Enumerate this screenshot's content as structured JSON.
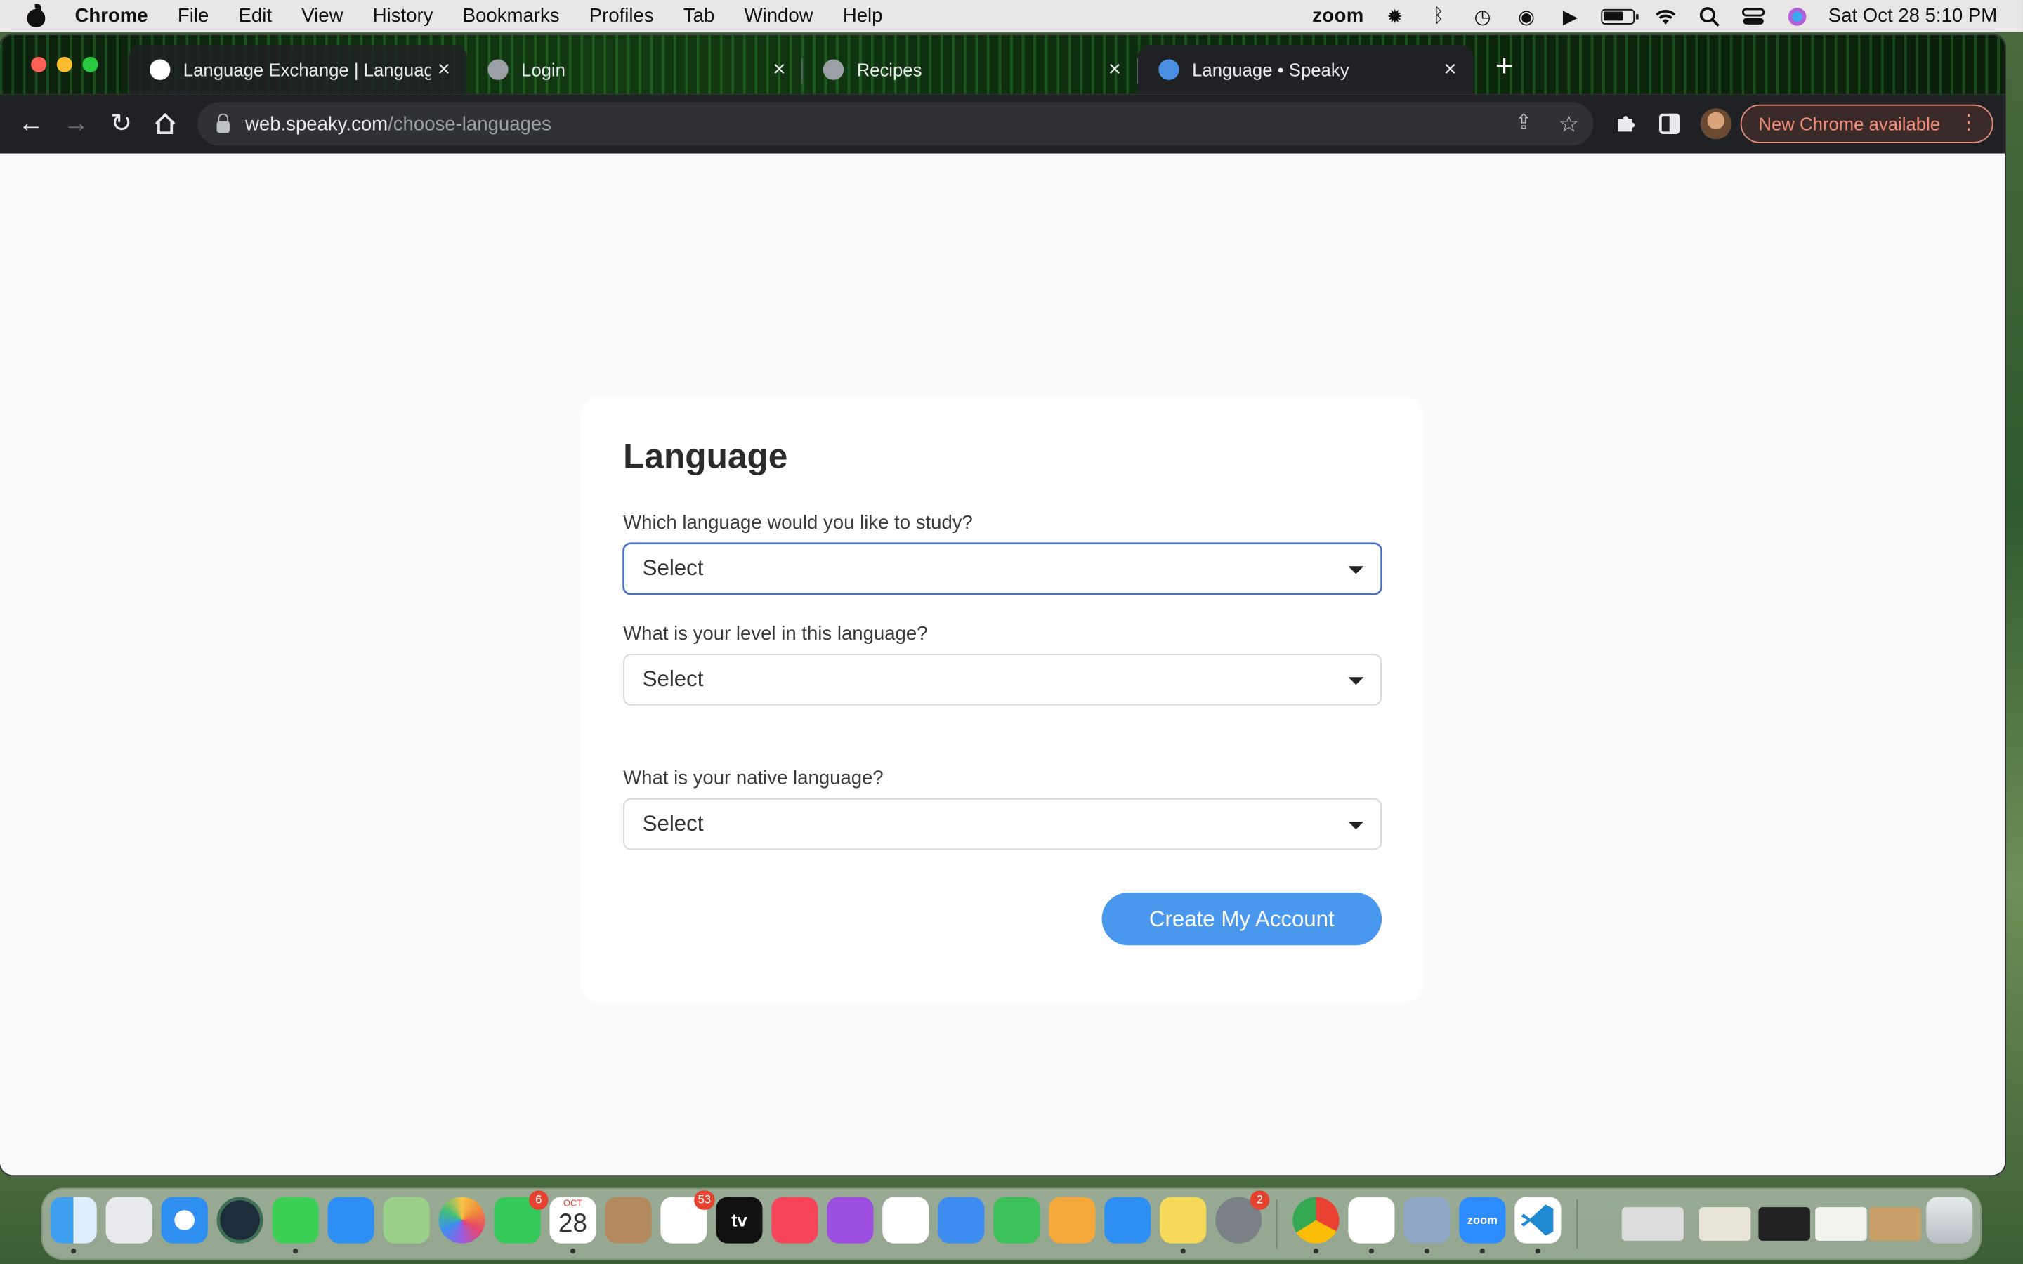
{
  "menubar": {
    "app_name": "Chrome",
    "items": [
      "File",
      "Edit",
      "View",
      "History",
      "Bookmarks",
      "Profiles",
      "Tab",
      "Window",
      "Help"
    ],
    "status_icons": [
      "zoom-icon",
      "brightness-icon",
      "bluetooth-icon",
      "time-machine-icon",
      "user-icon",
      "play-icon",
      "battery-icon",
      "wifi-icon",
      "spotlight-icon",
      "control-center-icon",
      "siri-icon"
    ],
    "zoom_label": "zoom",
    "datetime": "Sat Oct 28  5:10 PM"
  },
  "tabs": [
    {
      "title": "Language Exchange | Languag",
      "icon": "smiley-favicon",
      "state": "bg"
    },
    {
      "title": "Login",
      "icon": "globe-favicon",
      "state": "inactive"
    },
    {
      "title": "Recipes",
      "icon": "globe-favicon",
      "state": "inactive"
    },
    {
      "title": "Language • Speaky",
      "icon": "speaky-favicon",
      "state": "active"
    }
  ],
  "toolbar": {
    "url_host": "web.speaky.com",
    "url_path": "/choose-languages",
    "update_chip": "New Chrome available"
  },
  "form": {
    "title": "Language",
    "questions": [
      {
        "label": "Which language would you like to study?",
        "value": "Select",
        "focused": true
      },
      {
        "label": "What is your level in this language?",
        "value": "Select",
        "focused": false
      },
      {
        "label": "What is your native language?",
        "value": "Select",
        "focused": false
      }
    ],
    "submit_label": "Create My Account"
  },
  "dock": {
    "apps": [
      "finder",
      "launchpad",
      "safari",
      "time-machine",
      "messages",
      "mail",
      "maps",
      "photos",
      "facetime",
      "calendar",
      "contacts",
      "reminders",
      "apple-tv",
      "music",
      "podcasts",
      "news",
      "keynote",
      "numbers",
      "pages",
      "app-store",
      "notes",
      "system-settings",
      "chrome",
      "slack",
      "preview",
      "zoom",
      "vscode"
    ],
    "badges": {
      "facetime": "6",
      "reminders": "53",
      "system-settings": "2"
    },
    "calendar": {
      "month": "OCT",
      "day": "28"
    },
    "tv_label": "tv",
    "zoom_label": "zoom"
  },
  "colors": {
    "accent": "#4a97ee",
    "focus_border": "#4a74c9",
    "update_chip": "#f28b75"
  }
}
